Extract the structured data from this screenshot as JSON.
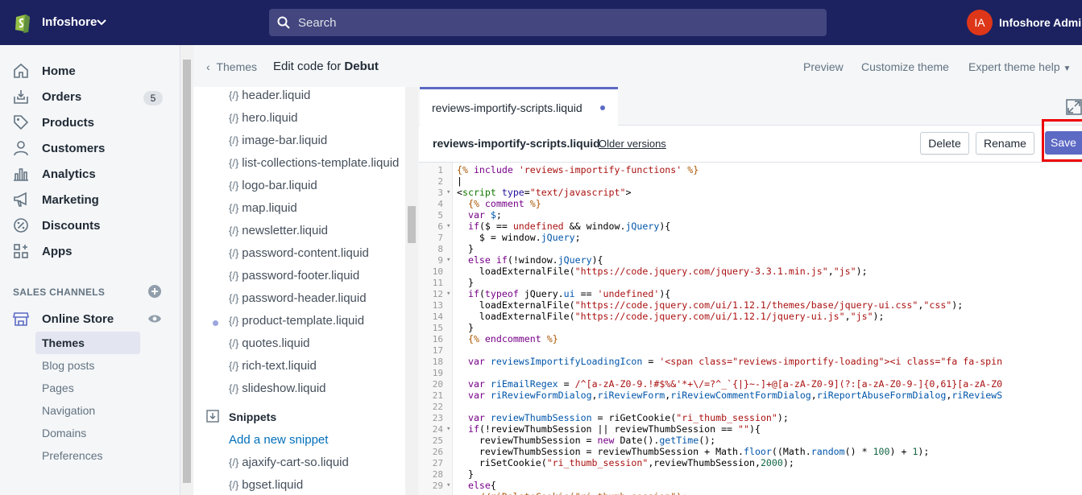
{
  "topbar": {
    "store": "Infoshore",
    "search_placeholder": "Search",
    "avatar_initials": "IA",
    "user": "Infoshore Admin"
  },
  "nav": {
    "items": [
      {
        "label": "Home",
        "icon": "home-icon"
      },
      {
        "label": "Orders",
        "icon": "orders-icon",
        "badge": "5"
      },
      {
        "label": "Products",
        "icon": "tag-icon"
      },
      {
        "label": "Customers",
        "icon": "person-icon"
      },
      {
        "label": "Analytics",
        "icon": "bar-chart-icon"
      },
      {
        "label": "Marketing",
        "icon": "megaphone-icon"
      },
      {
        "label": "Discounts",
        "icon": "discount-icon"
      },
      {
        "label": "Apps",
        "icon": "apps-icon"
      }
    ],
    "sales_channels": "SALES CHANNELS",
    "online_store": "Online Store",
    "subitems": [
      "Themes",
      "Blog posts",
      "Pages",
      "Navigation",
      "Domains",
      "Preferences"
    ]
  },
  "header": {
    "back": "Themes",
    "title_prefix": "Edit code for ",
    "title_theme": "Debut",
    "preview": "Preview",
    "customize": "Customize theme",
    "help": "Expert theme help"
  },
  "files": [
    "header.liquid",
    "hero.liquid",
    "image-bar.liquid",
    "list-collections-template.liquid",
    "logo-bar.liquid",
    "map.liquid",
    "newsletter.liquid",
    "password-content.liquid",
    "password-footer.liquid",
    "password-header.liquid",
    "product-template.liquid",
    "quotes.liquid",
    "rich-text.liquid",
    "slideshow.liquid"
  ],
  "snippets": {
    "heading": "Snippets",
    "add": "Add a new snippet",
    "files": [
      "ajaxify-cart-so.liquid",
      "bgset.liquid"
    ]
  },
  "editor": {
    "tab": "reviews-importify-scripts.liquid",
    "filename": "reviews-importify-scripts.liquid",
    "older": "Older versions",
    "delete": "Delete",
    "rename": "Rename",
    "save": "Save"
  },
  "code": {
    "line_numbers": [
      "1",
      "2",
      "3",
      "4",
      "5",
      "6",
      "7",
      "8",
      "9",
      "10",
      "11",
      "12",
      "13",
      "14",
      "15",
      "16",
      "17",
      "18",
      "19",
      "20",
      "21",
      "22",
      "23",
      "24",
      "25",
      "26",
      "27",
      "28",
      "29"
    ]
  },
  "colors": {
    "topbar": "#1c2260",
    "accent": "#5c6ac4",
    "highlight": "#e00000"
  }
}
